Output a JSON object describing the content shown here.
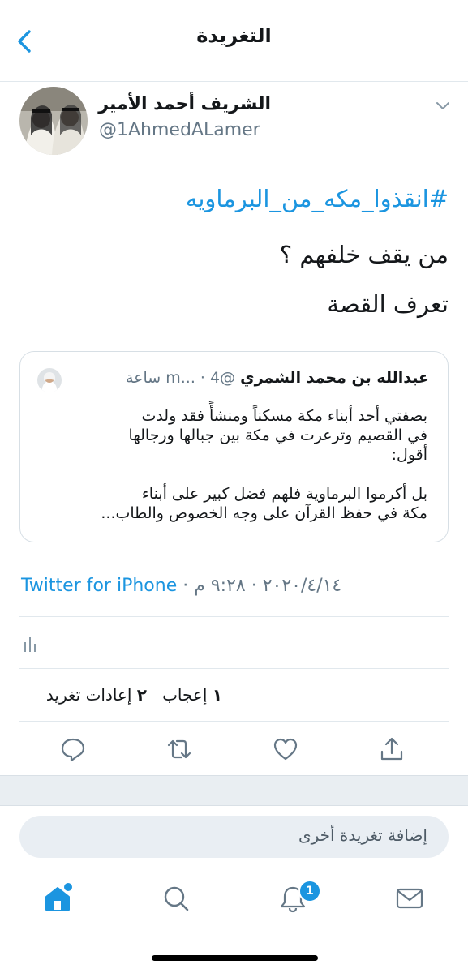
{
  "header": {
    "title": "التغريدة"
  },
  "tweet": {
    "author_name": "الشريف أحمد الأمير",
    "author_handle": "@1AhmedALamer",
    "hashtag": "#انقذوا_مكه_من_البرماويه",
    "lines": [
      "من يقف خلفهم ؟",
      "تعرف القصة"
    ]
  },
  "quoted": {
    "name": "عبدالله بن محمد الشمري",
    "handle": "@m...",
    "time": "4 ساعة",
    "lines": [
      "بصفتي أحد أبناء مكة مسكناً ومنشأً فقد ولدت",
      "في القصيم وترعرت في مكة بين جبالها ورجالها",
      "أقول:",
      "بل أكرموا البرماوية فلهم فضل كبير على أبناء",
      "مكة في حفظ القرآن على وجه الخصوص والطاب..."
    ]
  },
  "meta": {
    "source": "Twitter for iPhone",
    "separator": " · ",
    "date": "٢٠٢٠/٤/١٤",
    "time": "٩:٢٨ م"
  },
  "stats": {
    "likes_count": "١",
    "likes_label": "إعجاب",
    "retweets_count": "٢",
    "retweets_label": "إعادات تغريد"
  },
  "reply": {
    "placeholder": "إضافة تغريدة أخرى"
  },
  "tabbar": {
    "notifications_badge": "1"
  },
  "icons": {
    "back": "chevron-left-icon",
    "caret": "chevron-down-icon",
    "analytics": "analytics-icon",
    "reply": "reply-icon",
    "retweet": "retweet-icon",
    "like": "heart-icon",
    "share": "share-icon",
    "home": "home-icon",
    "search": "search-icon",
    "notifications": "bell-icon",
    "messages": "mail-icon"
  },
  "colors": {
    "accent": "#1b95e0",
    "secondary_text": "#657786",
    "divider": "#e1e8ed"
  }
}
